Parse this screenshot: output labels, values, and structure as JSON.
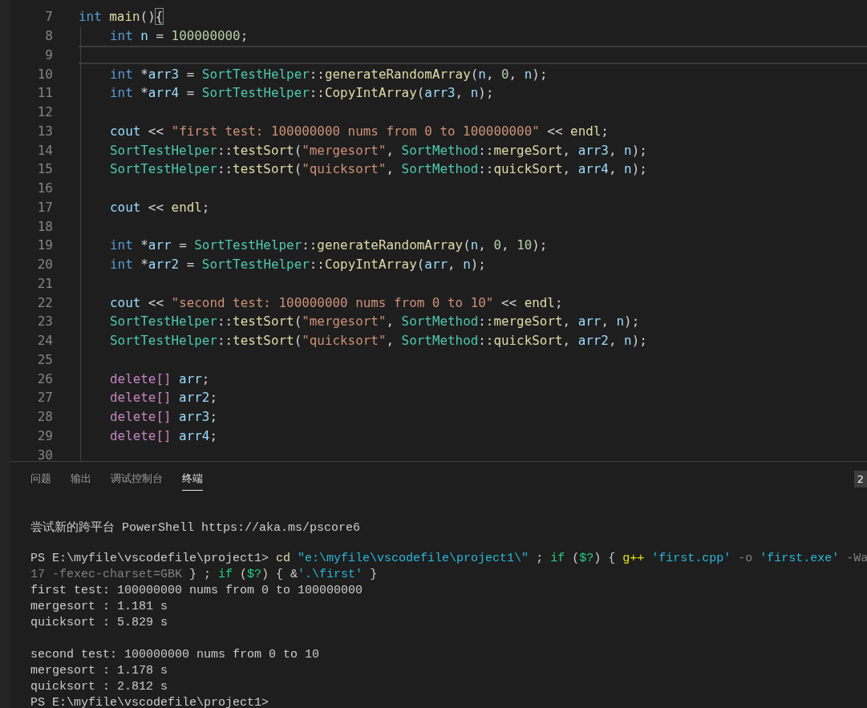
{
  "editor": {
    "lines": [
      {
        "number": "7",
        "current": false,
        "tokens": [
          {
            "kind": "kw",
            "text": "int "
          },
          {
            "kind": "fn",
            "text": "main"
          },
          {
            "kind": "p",
            "text": "()"
          },
          {
            "kind": "match",
            "text": "{"
          }
        ],
        "children": [
          {
            "number": "8",
            "current": false,
            "tokens": [
              {
                "kind": "kw",
                "text": "int "
              },
              {
                "kind": "var",
                "text": "n"
              },
              {
                "kind": "p",
                "text": " = "
              },
              {
                "kind": "num",
                "text": "100000000"
              },
              {
                "kind": "p",
                "text": ";"
              }
            ]
          },
          {
            "number": "9",
            "current": true
          },
          {
            "number": "10",
            "current": false,
            "tokens": [
              {
                "kind": "kw",
                "text": "int "
              },
              {
                "kind": "p",
                "text": "*"
              },
              {
                "kind": "var",
                "text": "arr3"
              },
              {
                "kind": "p",
                "text": " = "
              },
              {
                "kind": "cls",
                "text": "SortTestHelper"
              },
              {
                "kind": "p",
                "text": "::"
              },
              {
                "kind": "fn",
                "text": "generateRandomArray"
              },
              {
                "kind": "p",
                "text": "("
              },
              {
                "kind": "var",
                "text": "n"
              },
              {
                "kind": "p",
                "text": ", "
              },
              {
                "kind": "num",
                "text": "0"
              },
              {
                "kind": "p",
                "text": ", "
              },
              {
                "kind": "var",
                "text": "n"
              },
              {
                "kind": "p",
                "text": ");"
              }
            ]
          },
          {
            "number": "11",
            "current": false,
            "tokens": [
              {
                "kind": "kw",
                "text": "int "
              },
              {
                "kind": "p",
                "text": "*"
              },
              {
                "kind": "var",
                "text": "arr4"
              },
              {
                "kind": "p",
                "text": " = "
              },
              {
                "kind": "cls",
                "text": "SortTestHelper"
              },
              {
                "kind": "p",
                "text": "::"
              },
              {
                "kind": "fn",
                "text": "CopyIntArray"
              },
              {
                "kind": "p",
                "text": "("
              },
              {
                "kind": "var",
                "text": "arr3"
              },
              {
                "kind": "p",
                "text": ", "
              },
              {
                "kind": "var",
                "text": "n"
              },
              {
                "kind": "p",
                "text": ");"
              }
            ]
          },
          {
            "number": "12",
            "current": false
          },
          {
            "number": "13",
            "current": false,
            "tokens": [
              {
                "kind": "var",
                "text": "cout"
              },
              {
                "kind": "p",
                "text": " << "
              },
              {
                "kind": "str",
                "text": "\"first test: 100000000 nums from 0 to 100000000\""
              },
              {
                "kind": "p",
                "text": " << "
              },
              {
                "kind": "fn",
                "text": "endl"
              },
              {
                "kind": "p",
                "text": ";"
              }
            ]
          },
          {
            "number": "14",
            "current": false,
            "tokens": [
              {
                "kind": "cls",
                "text": "SortTestHelper"
              },
              {
                "kind": "p",
                "text": "::"
              },
              {
                "kind": "fn",
                "text": "testSort"
              },
              {
                "kind": "p",
                "text": "("
              },
              {
                "kind": "str",
                "text": "\"mergesort\""
              },
              {
                "kind": "p",
                "text": ", "
              },
              {
                "kind": "cls",
                "text": "SortMethod"
              },
              {
                "kind": "p",
                "text": "::"
              },
              {
                "kind": "fn",
                "text": "mergeSort"
              },
              {
                "kind": "p",
                "text": ", "
              },
              {
                "kind": "var",
                "text": "arr3"
              },
              {
                "kind": "p",
                "text": ", "
              },
              {
                "kind": "var",
                "text": "n"
              },
              {
                "kind": "p",
                "text": ");"
              }
            ]
          },
          {
            "number": "15",
            "current": false,
            "tokens": [
              {
                "kind": "cls",
                "text": "SortTestHelper"
              },
              {
                "kind": "p",
                "text": "::"
              },
              {
                "kind": "fn",
                "text": "testSort"
              },
              {
                "kind": "p",
                "text": "("
              },
              {
                "kind": "str",
                "text": "\"quicksort\""
              },
              {
                "kind": "p",
                "text": ", "
              },
              {
                "kind": "cls",
                "text": "SortMethod"
              },
              {
                "kind": "p",
                "text": "::"
              },
              {
                "kind": "fn",
                "text": "quickSort"
              },
              {
                "kind": "p",
                "text": ", "
              },
              {
                "kind": "var",
                "text": "arr4"
              },
              {
                "kind": "p",
                "text": ", "
              },
              {
                "kind": "var",
                "text": "n"
              },
              {
                "kind": "p",
                "text": ");"
              }
            ]
          },
          {
            "number": "16",
            "current": false
          },
          {
            "number": "17",
            "current": false,
            "tokens": [
              {
                "kind": "var",
                "text": "cout"
              },
              {
                "kind": "p",
                "text": " << "
              },
              {
                "kind": "fn",
                "text": "endl"
              },
              {
                "kind": "p",
                "text": ";"
              }
            ]
          },
          {
            "number": "18",
            "current": false
          },
          {
            "number": "19",
            "current": false,
            "tokens": [
              {
                "kind": "kw",
                "text": "int "
              },
              {
                "kind": "p",
                "text": "*"
              },
              {
                "kind": "var",
                "text": "arr"
              },
              {
                "kind": "p",
                "text": " = "
              },
              {
                "kind": "cls",
                "text": "SortTestHelper"
              },
              {
                "kind": "p",
                "text": "::"
              },
              {
                "kind": "fn",
                "text": "generateRandomArray"
              },
              {
                "kind": "p",
                "text": "("
              },
              {
                "kind": "var",
                "text": "n"
              },
              {
                "kind": "p",
                "text": ", "
              },
              {
                "kind": "num",
                "text": "0"
              },
              {
                "kind": "p",
                "text": ", "
              },
              {
                "kind": "num",
                "text": "10"
              },
              {
                "kind": "p",
                "text": ");"
              }
            ]
          },
          {
            "number": "20",
            "current": false,
            "tokens": [
              {
                "kind": "kw",
                "text": "int "
              },
              {
                "kind": "p",
                "text": "*"
              },
              {
                "kind": "var",
                "text": "arr2"
              },
              {
                "kind": "p",
                "text": " = "
              },
              {
                "kind": "cls",
                "text": "SortTestHelper"
              },
              {
                "kind": "p",
                "text": "::"
              },
              {
                "kind": "fn",
                "text": "CopyIntArray"
              },
              {
                "kind": "p",
                "text": "("
              },
              {
                "kind": "var",
                "text": "arr"
              },
              {
                "kind": "p",
                "text": ", "
              },
              {
                "kind": "var",
                "text": "n"
              },
              {
                "kind": "p",
                "text": ");"
              }
            ]
          },
          {
            "number": "21",
            "current": false
          },
          {
            "number": "22",
            "current": false,
            "tokens": [
              {
                "kind": "var",
                "text": "cout"
              },
              {
                "kind": "p",
                "text": " << "
              },
              {
                "kind": "str",
                "text": "\"second test: 100000000 nums from 0 to 10\""
              },
              {
                "kind": "p",
                "text": " << "
              },
              {
                "kind": "fn",
                "text": "endl"
              },
              {
                "kind": "p",
                "text": ";"
              }
            ]
          },
          {
            "number": "23",
            "current": false,
            "tokens": [
              {
                "kind": "cls",
                "text": "SortTestHelper"
              },
              {
                "kind": "p",
                "text": "::"
              },
              {
                "kind": "fn",
                "text": "testSort"
              },
              {
                "kind": "p",
                "text": "("
              },
              {
                "kind": "str",
                "text": "\"mergesort\""
              },
              {
                "kind": "p",
                "text": ", "
              },
              {
                "kind": "cls",
                "text": "SortMethod"
              },
              {
                "kind": "p",
                "text": "::"
              },
              {
                "kind": "fn",
                "text": "mergeSort"
              },
              {
                "kind": "p",
                "text": ", "
              },
              {
                "kind": "var",
                "text": "arr"
              },
              {
                "kind": "p",
                "text": ", "
              },
              {
                "kind": "var",
                "text": "n"
              },
              {
                "kind": "p",
                "text": ");"
              }
            ]
          },
          {
            "number": "24",
            "current": false,
            "tokens": [
              {
                "kind": "cls",
                "text": "SortTestHelper"
              },
              {
                "kind": "p",
                "text": "::"
              },
              {
                "kind": "fn",
                "text": "testSort"
              },
              {
                "kind": "p",
                "text": "("
              },
              {
                "kind": "str",
                "text": "\"quicksort\""
              },
              {
                "kind": "p",
                "text": ", "
              },
              {
                "kind": "cls",
                "text": "SortMethod"
              },
              {
                "kind": "p",
                "text": "::"
              },
              {
                "kind": "fn",
                "text": "quickSort"
              },
              {
                "kind": "p",
                "text": ", "
              },
              {
                "kind": "var",
                "text": "arr2"
              },
              {
                "kind": "p",
                "text": ", "
              },
              {
                "kind": "var",
                "text": "n"
              },
              {
                "kind": "p",
                "text": ");"
              }
            ]
          },
          {
            "number": "25",
            "current": false
          },
          {
            "number": "26",
            "current": false,
            "tokens": [
              {
                "kind": "ctl",
                "text": "delete[] "
              },
              {
                "kind": "var",
                "text": "arr"
              },
              {
                "kind": "p",
                "text": ";"
              }
            ]
          },
          {
            "number": "27",
            "current": false,
            "tokens": [
              {
                "kind": "ctl",
                "text": "delete[] "
              },
              {
                "kind": "var",
                "text": "arr2"
              },
              {
                "kind": "p",
                "text": ";"
              }
            ]
          },
          {
            "number": "28",
            "current": false,
            "tokens": [
              {
                "kind": "ctl",
                "text": "delete[] "
              },
              {
                "kind": "var",
                "text": "arr3"
              },
              {
                "kind": "p",
                "text": ";"
              }
            ]
          },
          {
            "number": "29",
            "current": false,
            "tokens": [
              {
                "kind": "ctl",
                "text": "delete[] "
              },
              {
                "kind": "var",
                "text": "arr4"
              },
              {
                "kind": "p",
                "text": ";"
              }
            ]
          },
          {
            "number": "30",
            "current": false
          }
        ]
      }
    ]
  },
  "panel": {
    "tabs": [
      {
        "label": "问题",
        "selected": false
      },
      {
        "label": "输出",
        "selected": false
      },
      {
        "label": "调试控制台",
        "selected": false
      },
      {
        "label": "终端",
        "selected": true
      }
    ],
    "terminal_select": "2",
    "terminal": [
      {
        "lines": [
          {
            "tokens": [
              {
                "kind": "p",
                "text": "尝试新的跨平台 PowerShell https://aka.ms/pscore6"
              }
            ]
          }
        ]
      },
      {
        "lines": [
          {
            "tokens": [
              {
                "kind": "p",
                "text": "PS E:\\myfile\\vscodefile\\project1> "
              },
              {
                "kind": "cmd",
                "text": "cd "
              },
              {
                "kind": "str",
                "text": "\"e:\\myfile\\vscodefile\\project1\\\""
              },
              {
                "kind": "p",
                "text": " ; "
              },
              {
                "kind": "kw",
                "text": "if "
              },
              {
                "kind": "p",
                "text": "("
              },
              {
                "kind": "kw",
                "text": "$?"
              },
              {
                "kind": "p",
                "text": ") { "
              },
              {
                "kind": "exe",
                "text": "g++ "
              },
              {
                "kind": "str",
                "text": "'first.cpp' "
              },
              {
                "kind": "param",
                "text": "-o "
              },
              {
                "kind": "str",
                "text": "'first.exe' "
              },
              {
                "kind": "param",
                "text": "-Wa"
              }
            ]
          },
          {
            "tokens": [
              {
                "kind": "param",
                "text": "17 -fexec-charset=GBK"
              },
              {
                "kind": "p",
                "text": " } ; "
              },
              {
                "kind": "kw",
                "text": "if "
              },
              {
                "kind": "p",
                "text": "("
              },
              {
                "kind": "kw",
                "text": "$?"
              },
              {
                "kind": "p",
                "text": ") { &"
              },
              {
                "kind": "str",
                "text": "'.\\first'"
              },
              {
                "kind": "p",
                "text": " }"
              }
            ]
          },
          {
            "tokens": [
              {
                "kind": "p",
                "text": "first test: 100000000 nums from 0 to 100000000"
              }
            ]
          },
          {
            "tokens": [
              {
                "kind": "p",
                "text": "mergesort : 1.181 s"
              }
            ]
          },
          {
            "tokens": [
              {
                "kind": "p",
                "text": "quicksort : 5.829 s"
              }
            ]
          }
        ]
      },
      {
        "lines": [
          {
            "tokens": [
              {
                "kind": "p",
                "text": "second test: 100000000 nums from 0 to 10"
              }
            ]
          },
          {
            "tokens": [
              {
                "kind": "p",
                "text": "mergesort : 1.178 s"
              }
            ]
          },
          {
            "tokens": [
              {
                "kind": "p",
                "text": "quicksort : 2.812 s"
              }
            ]
          },
          {
            "tokens": [
              {
                "kind": "p",
                "text": "PS E:\\myfile\\vscodefile\\project1>"
              }
            ]
          }
        ]
      }
    ]
  }
}
